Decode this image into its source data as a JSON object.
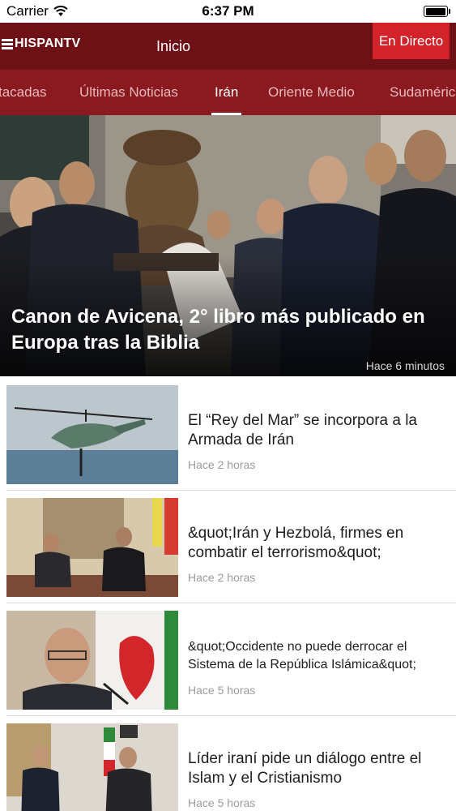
{
  "status_bar": {
    "carrier": "Carrier",
    "time": "6:37 PM",
    "battery_level": 1.0,
    "icons": [
      "wifi-icon",
      "battery-icon"
    ]
  },
  "header": {
    "logo_text": "HISPANTV",
    "title": "Inicio",
    "live_button": "En Directo",
    "colors": {
      "header": "#6e1116",
      "tabs": "#8a1a1f",
      "live": "#d2232a"
    }
  },
  "tabs": [
    {
      "label": "tacadas"
    },
    {
      "label": "Últimas Noticias"
    },
    {
      "label": "Irán",
      "active": true
    },
    {
      "label": "Oriente Medio"
    },
    {
      "label": "Sudaméric"
    }
  ],
  "hero": {
    "title": "Canon de Avicena, 2° libro más publicado en Europa tras la Biblia",
    "time": "Hace 6 minutos"
  },
  "news": [
    {
      "title": "El “Rey del Mar” se incorpora a la Armada de Irán",
      "time": "Hace 2 horas"
    },
    {
      "title": "&quot;Irán y Hezbolá, firmes en combatir el terrorismo&quot;",
      "time": "Hace 2 horas"
    },
    {
      "title": "&quot;Occidente no puede derrocar el Sistema de la República Islámica&quot;",
      "time": "Hace 5 horas"
    },
    {
      "title": "Líder iraní pide un diálogo entre el Islam y el Cristianismo",
      "time": "Hace 5 horas"
    }
  ]
}
